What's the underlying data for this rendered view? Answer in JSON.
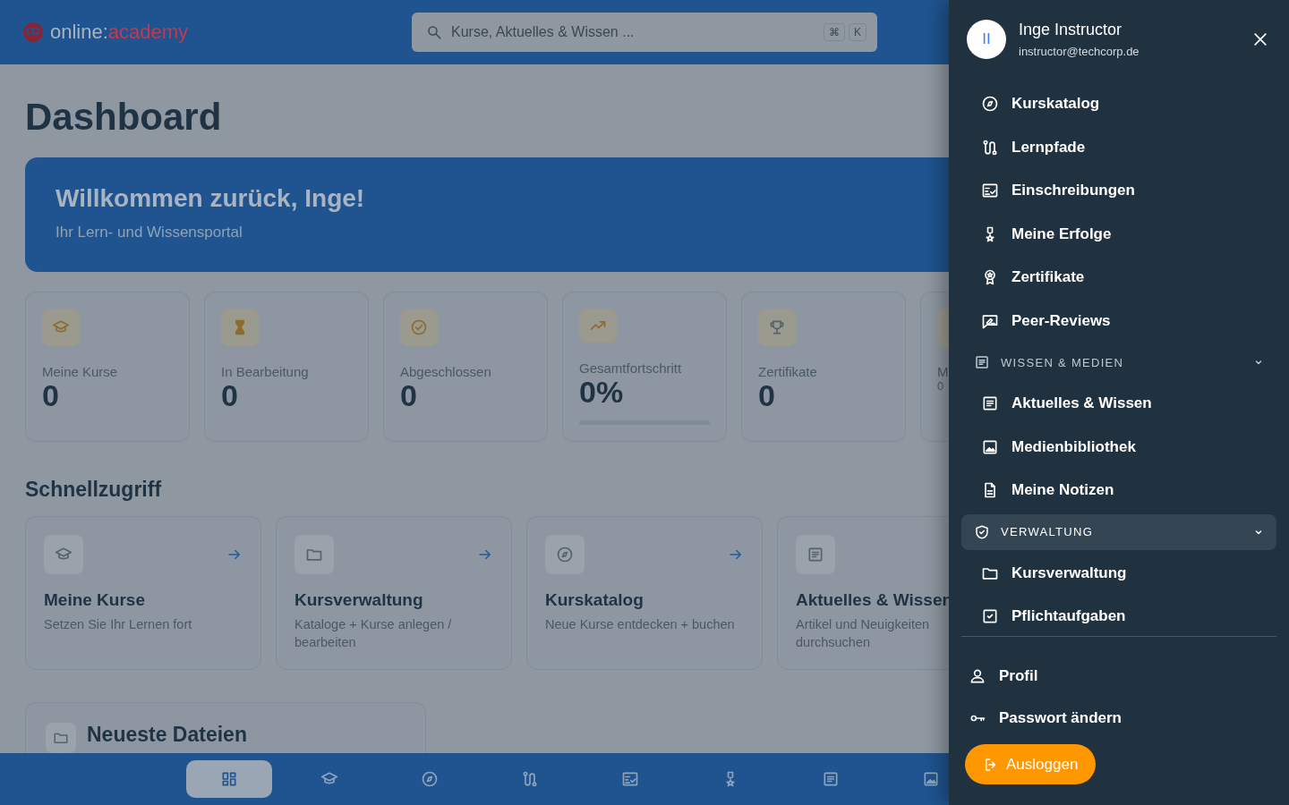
{
  "header": {
    "logo": {
      "prefix": "online:",
      "suffix": "academy"
    },
    "search": {
      "placeholder": "Kurse, Aktuelles & Wissen ..."
    },
    "shortcut_keys": [
      "⌘",
      "K"
    ]
  },
  "page_title": "Dashboard",
  "welcome": {
    "title": "Willkommen zurück, Inge!",
    "subtitle": "Ihr Lern- und Wissensportal"
  },
  "stats": [
    {
      "label": "Meine Kurse",
      "value": "0",
      "color": "#8d6b2c"
    },
    {
      "label": "In Bearbeitung",
      "value": "0",
      "color": "#8d6b2c"
    },
    {
      "label": "Abgeschlossen",
      "value": "0",
      "color": "#8d6b2c"
    },
    {
      "label": "Gesamtfortschritt",
      "value": "0%",
      "color": "#8d6b2c",
      "level": 0
    },
    {
      "label": "Zertifikate",
      "value": "0",
      "color": "#56626e"
    },
    {
      "label": "M",
      "note": "0"
    }
  ],
  "quick_access": {
    "title": "Schnellzugriff",
    "items": [
      {
        "title": "Meine Kurse",
        "description": "Setzen Sie Ihr Lernen fort"
      },
      {
        "title": "Kursverwaltung",
        "description": "Kataloge + Kurse anlegen / bearbeiten"
      },
      {
        "title": "Kurskatalog",
        "description": "Neue Kurse entdecken + buchen"
      },
      {
        "title": "Aktuelles & Wissen",
        "description": "Artikel und Neuigkeiten durchsuchen"
      }
    ]
  },
  "recent_files": {
    "title": "Neueste Dateien"
  },
  "bottom_nav": [
    {
      "selected": true
    },
    {
      "selected": false
    },
    {
      "selected": false
    },
    {
      "selected": false
    },
    {
      "selected": false
    },
    {
      "selected": false
    },
    {
      "selected": false
    },
    {
      "selected": false
    }
  ],
  "drawer": {
    "user": {
      "initials": "II",
      "name": "Inge Instructor",
      "email": "instructor@techcorp.de"
    },
    "nav": [
      {
        "kind": "link",
        "label": "Kurskatalog"
      },
      {
        "kind": "link",
        "label": "Lernpfade"
      },
      {
        "kind": "link",
        "label": "Einschreibungen"
      },
      {
        "kind": "link",
        "label": "Meine Erfolge"
      },
      {
        "kind": "link",
        "label": "Zertifikate"
      },
      {
        "kind": "link",
        "label": "Peer-Reviews"
      },
      {
        "kind": "section",
        "label": "WISSEN & MEDIEN",
        "expanded": true,
        "selected": false,
        "children": [
          {
            "label": "Aktuelles & Wissen"
          },
          {
            "label": "Medienbibliothek"
          },
          {
            "label": "Meine Notizen"
          }
        ]
      },
      {
        "kind": "section",
        "label": "VERWALTUNG",
        "expanded": true,
        "selected": true,
        "children": [
          {
            "label": "Kursverwaltung"
          },
          {
            "label": "Pflichtaufgaben"
          }
        ]
      }
    ],
    "footer": [
      {
        "label": "Profil"
      },
      {
        "label": "Passwort ändern"
      }
    ],
    "logout": "Ausloggen"
  }
}
